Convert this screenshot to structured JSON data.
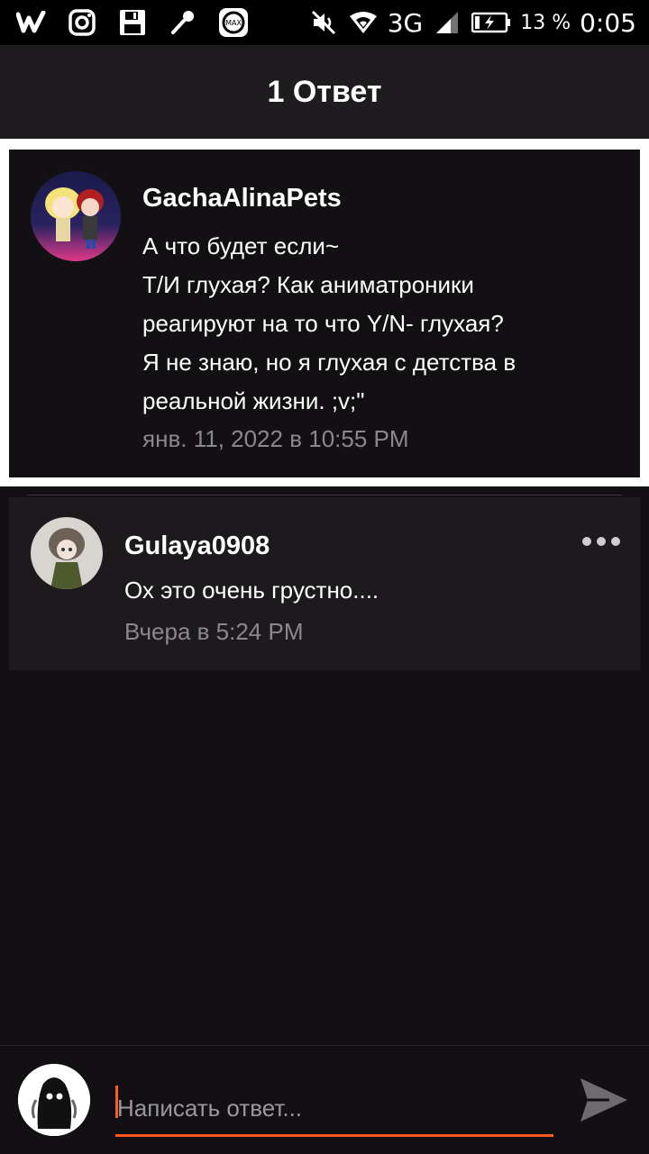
{
  "status_bar": {
    "network": "3G",
    "battery_percent": "13 %",
    "time": "0:05",
    "icons": [
      "wattpad-icon",
      "instagram-icon",
      "save-icon",
      "microphone-icon",
      "max-app-icon",
      "muted-icon",
      "wifi-icon",
      "signal-icon",
      "battery-charging-icon"
    ]
  },
  "header": {
    "title": "1 Ответ"
  },
  "parent_comment": {
    "author": "GachaAlinaPets",
    "lines": [
      "А что будет если~",
      "Т/И глухая? Как аниматроники",
      "реагируют на то что Y/N- глухая?",
      "Я не знаю, но я глухая с детства в",
      "реальной жизни. ;v;\""
    ],
    "timestamp": "янв. 11, 2022 в 10:55 PM"
  },
  "reply": {
    "author": "Gulaya0908",
    "text": "Ох это очень грустно....",
    "timestamp": "Вчера в 5:24 PM"
  },
  "composer": {
    "placeholder": "Написать ответ..."
  },
  "colors": {
    "accent": "#ff5a24",
    "background": "#121013",
    "card": "#1c1a1d",
    "muted_text": "#8a888b"
  }
}
